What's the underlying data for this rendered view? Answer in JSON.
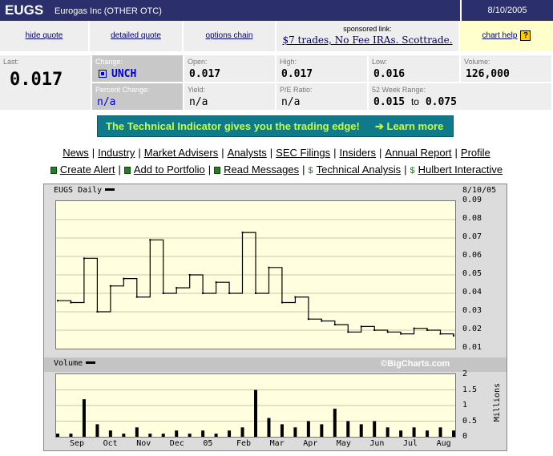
{
  "header": {
    "symbol": "EUGS",
    "company": "Eurogas Inc (OTHER OTC)",
    "date": "8/10/2005"
  },
  "links": {
    "hide_quote": "hide quote",
    "detailed_quote": "detailed quote",
    "options_chain": "options chain"
  },
  "sponsor": {
    "caption": "sponsored link:",
    "link": "$7 trades, No Fee IRAs. Scottrade."
  },
  "help": {
    "label": "chart help",
    "icon": "?"
  },
  "quote": {
    "last_label": "Last:",
    "last": "0.017",
    "change_label": "Change:",
    "change": "UNCH",
    "open_label": "Open:",
    "open": "0.017",
    "high_label": "High:",
    "high": "0.017",
    "low_label": "Low:",
    "low": "0.016",
    "volume_label": "Volume:",
    "volume": "126,000",
    "pct_label": "Percent Change:",
    "pct": "n/a",
    "yield_label": "Yield:",
    "yield": "n/a",
    "pe_label": "P/E Ratio:",
    "pe": "n/a",
    "range_label": "52 Week Range:",
    "range_low": "0.015",
    "range_to": "to",
    "range_high": "0.075"
  },
  "banner": {
    "text": "The Technical Indicator gives you the trading edge!",
    "cta": "➔ Learn more"
  },
  "nav1": [
    "News",
    "Industry",
    "Market Advisers",
    "Analysts",
    "SEC Filings",
    "Insiders",
    "Annual Report",
    "Profile"
  ],
  "nav2": [
    "Create Alert",
    "Add to Portfolio",
    "Read Messages",
    "Technical Analysis",
    "Hulbert Interactive"
  ],
  "chart": {
    "title": "EUGS Daily",
    "date": "8/10/05",
    "volume_title": "Volume",
    "credit": "©BigCharts.com",
    "volume_unit": "Millions",
    "price_ticks": [
      "0.09",
      "0.08",
      "0.07",
      "0.06",
      "0.05",
      "0.04",
      "0.03",
      "0.02",
      "0.01"
    ],
    "volume_ticks": [
      "2",
      "1.5",
      "1",
      "0.5",
      "0"
    ],
    "month_labels": [
      "Sep",
      "Oct",
      "Nov",
      "Dec",
      "05",
      "Feb",
      "Mar",
      "Apr",
      "May",
      "Jun",
      "Jul",
      "Aug"
    ]
  },
  "chart_data": {
    "type": "line",
    "title": "EUGS Daily",
    "ylim": [
      0.01,
      0.09
    ],
    "x": [
      "Aug-04",
      "Sep",
      "Sep",
      "Sep",
      "Oct",
      "Oct",
      "Oct",
      "Nov",
      "Nov",
      "Nov",
      "Dec",
      "Dec",
      "Dec",
      "05",
      "05",
      "05",
      "Feb",
      "Feb",
      "Mar",
      "Mar",
      "Mar",
      "Apr",
      "Apr",
      "May",
      "May",
      "Jun",
      "Jun",
      "Jul",
      "Jul",
      "Aug",
      "Aug"
    ],
    "series": [
      {
        "values": [
          0.036,
          0.035,
          0.059,
          0.03,
          0.044,
          0.048,
          0.038,
          0.069,
          0.04,
          0.043,
          0.05,
          0.04,
          0.046,
          0.04,
          0.073,
          0.04,
          0.054,
          0.035,
          0.038,
          0.026,
          0.025,
          0.023,
          0.019,
          0.022,
          0.02,
          0.019,
          0.018,
          0.021,
          0.02,
          0.018,
          0.017
        ]
      },
      {
        "values": [
          0.1,
          0.1,
          1.2,
          0.4,
          0.2,
          0.1,
          0.3,
          0.1,
          0.1,
          0.2,
          0.1,
          0.2,
          0.1,
          0.2,
          0.3,
          1.5,
          0.6,
          0.4,
          0.3,
          0.5,
          0.4,
          0.9,
          0.5,
          0.4,
          0.5,
          0.3,
          0.2,
          0.3,
          0.2,
          0.3,
          0.2
        ]
      }
    ],
    "volume_ylim": [
      0,
      2
    ]
  }
}
